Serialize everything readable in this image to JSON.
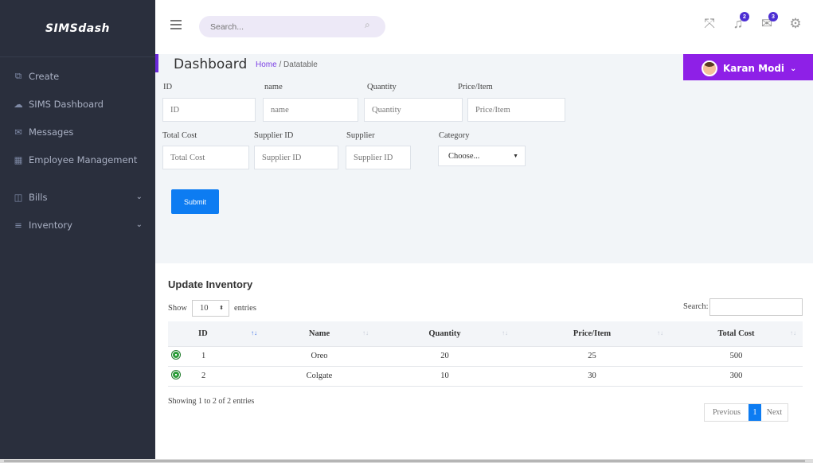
{
  "brand": "SIMSdash",
  "sidebar": {
    "items": [
      {
        "label": "Create",
        "icon": "copy-icon"
      },
      {
        "label": "SIMS Dashboard",
        "icon": "cloud-icon"
      },
      {
        "label": "Messages",
        "icon": "envelope-icon"
      },
      {
        "label": "Employee Management",
        "icon": "grid-icon"
      },
      {
        "label": "Bills",
        "icon": "columns-icon"
      },
      {
        "label": "Inventory",
        "icon": "list-icon"
      }
    ]
  },
  "header": {
    "search_placeholder": "Search...",
    "notifications_badge": "2",
    "messages_badge": "3"
  },
  "page": {
    "title": "Dashboard",
    "breadcrumb_home": "Home",
    "breadcrumb_sep": "/",
    "breadcrumb_current": "Datatable"
  },
  "user": {
    "name": "Karan Modi"
  },
  "form": {
    "id_label": "ID",
    "id_placeholder": "ID",
    "name_label": "name",
    "name_placeholder": "name",
    "quantity_label": "Quantity",
    "quantity_placeholder": "Quantity",
    "price_label": "Price/Item",
    "price_placeholder": "Price/Item",
    "total_label": "Total Cost",
    "total_placeholder": "Total Cost",
    "supplier_id_label": "Supplier ID",
    "supplier_id_placeholder": "Supplier ID",
    "supplier_label": "Supplier",
    "supplier_placeholder": "Supplier ID",
    "category_label": "Category",
    "category_value": "Choose...",
    "submit_label": "Submit"
  },
  "table": {
    "title": "Update Inventory",
    "show_label": "Show",
    "entries_value": "10",
    "entries_label": "entries",
    "search_label": "Search:",
    "columns": [
      "ID",
      "Name",
      "Quantity",
      "Price/Item",
      "Total Cost"
    ],
    "rows": [
      [
        "1",
        "Oreo",
        "20",
        "25",
        "500"
      ],
      [
        "2",
        "Colgate",
        "10",
        "30",
        "300"
      ]
    ],
    "info": "Showing 1 to 2 of 2 entries",
    "prev": "Previous",
    "page": "1",
    "next": "Next"
  },
  "colors": {
    "accent": "#8e20e7",
    "sidebar": "#2a2f3d",
    "primary": "#0d7cf2"
  }
}
